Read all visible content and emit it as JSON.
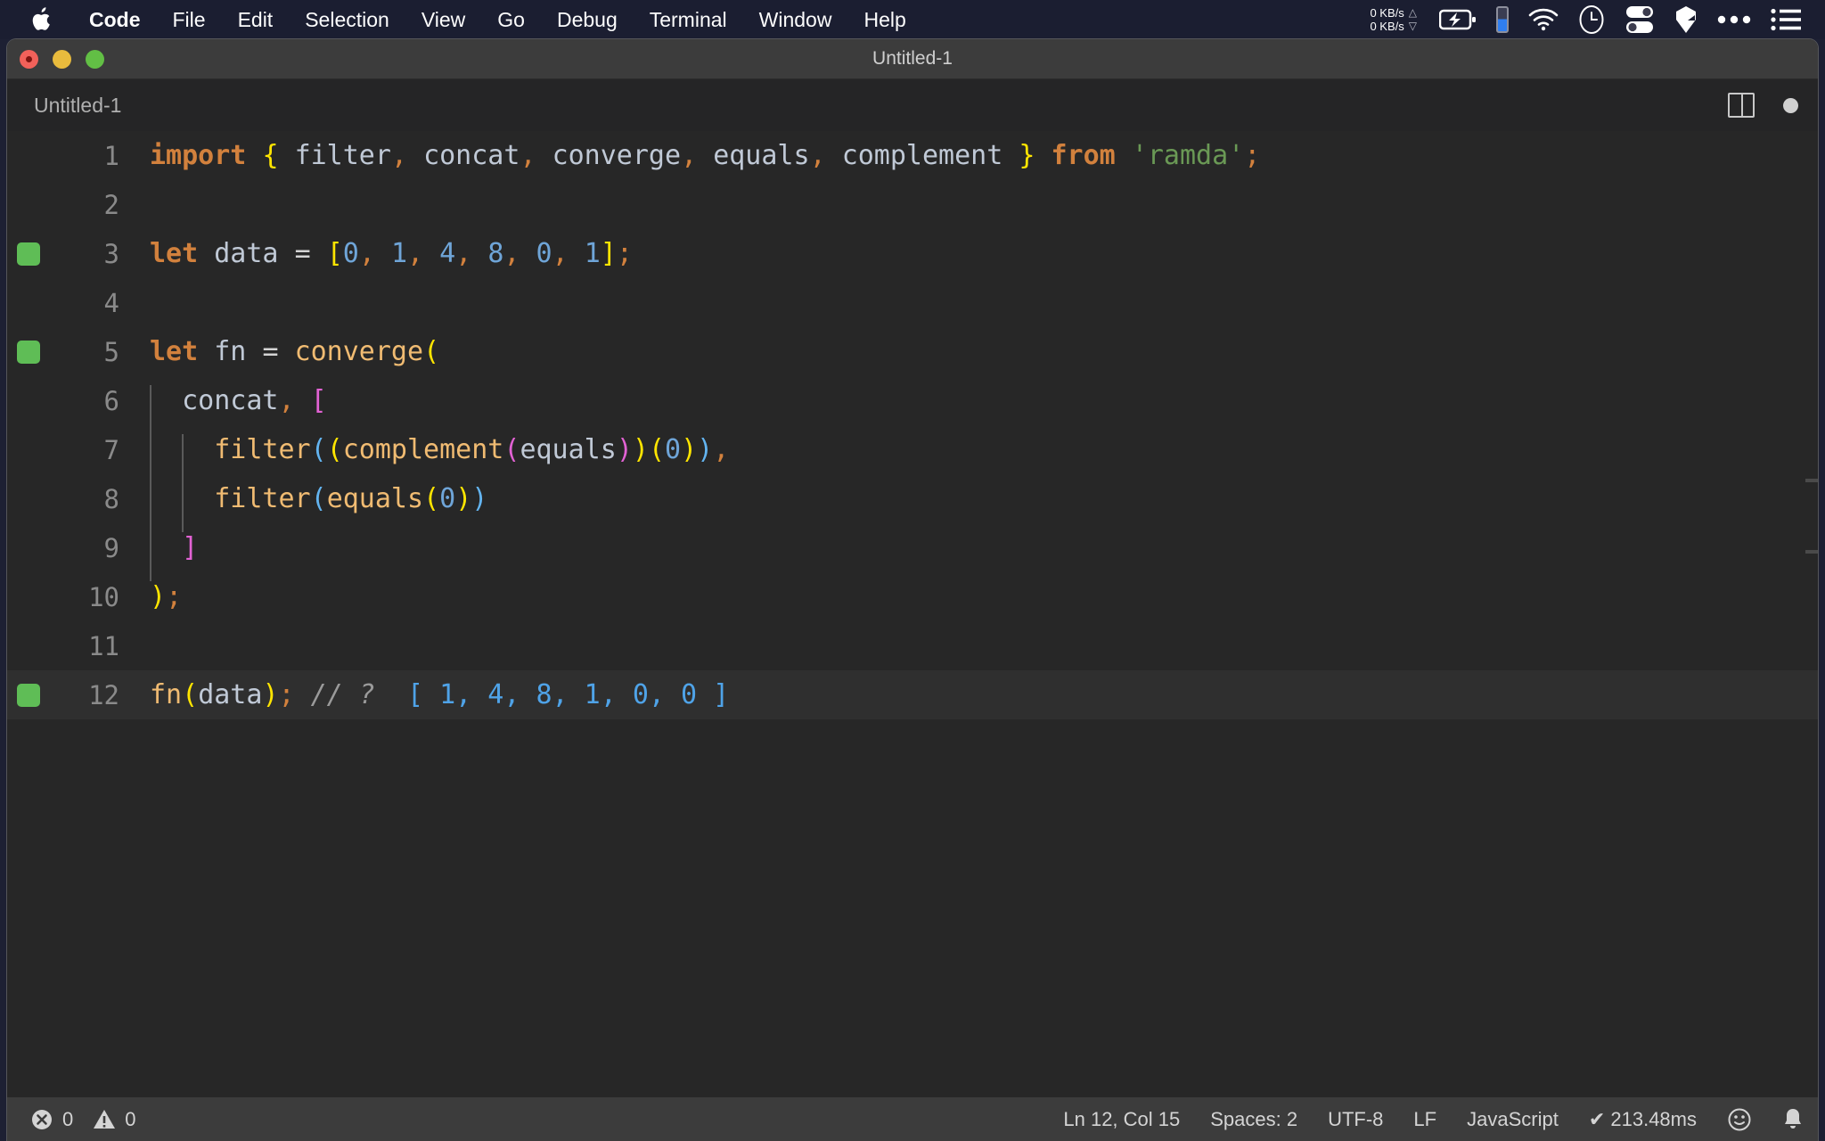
{
  "menubar": {
    "apple_icon": "apple-logo-icon",
    "items": [
      {
        "label": "Code",
        "bold": true
      },
      {
        "label": "File",
        "bold": false
      },
      {
        "label": "Edit",
        "bold": false
      },
      {
        "label": "Selection",
        "bold": false
      },
      {
        "label": "View",
        "bold": false
      },
      {
        "label": "Go",
        "bold": false
      },
      {
        "label": "Debug",
        "bold": false
      },
      {
        "label": "Terminal",
        "bold": false
      },
      {
        "label": "Window",
        "bold": false
      },
      {
        "label": "Help",
        "bold": false
      }
    ],
    "network": {
      "upload": "0 KB/s",
      "download": "0 KB/s",
      "up_arrow": "△",
      "down_arrow": "▽"
    },
    "icons": [
      "battery-charging-icon",
      "blue-level-indicator",
      "wifi-icon",
      "clock-icon",
      "toggles-icon",
      "shield-icon",
      "ellipsis-icon",
      "list-icon"
    ]
  },
  "window": {
    "title": "Untitled-1",
    "traffic_lights": [
      "close-button",
      "minimize-button",
      "zoom-button"
    ]
  },
  "tabstrip": {
    "tab_label": "Untitled-1",
    "split_editor_icon": "split-editor-icon",
    "unsaved_dot": "unsaved-indicator"
  },
  "editor": {
    "language": "JavaScript",
    "active_line": 12,
    "breakpoint_lines": [
      3,
      5,
      12
    ],
    "lines": [
      {
        "n": "1",
        "tokens": [
          {
            "t": "import",
            "c": "t-kw"
          },
          {
            "t": " ",
            "c": "t-op"
          },
          {
            "t": "{",
            "c": "t-y"
          },
          {
            "t": " ",
            "c": "t-op"
          },
          {
            "t": "filter",
            "c": "t-id"
          },
          {
            "t": ",",
            "c": "t-punc-or"
          },
          {
            "t": " ",
            "c": "t-op"
          },
          {
            "t": "concat",
            "c": "t-id"
          },
          {
            "t": ",",
            "c": "t-punc-or"
          },
          {
            "t": " ",
            "c": "t-op"
          },
          {
            "t": "converge",
            "c": "t-id"
          },
          {
            "t": ",",
            "c": "t-punc-or"
          },
          {
            "t": " ",
            "c": "t-op"
          },
          {
            "t": "equals",
            "c": "t-id"
          },
          {
            "t": ",",
            "c": "t-punc-or"
          },
          {
            "t": " ",
            "c": "t-op"
          },
          {
            "t": "complement",
            "c": "t-id"
          },
          {
            "t": " ",
            "c": "t-op"
          },
          {
            "t": "}",
            "c": "t-y"
          },
          {
            "t": " ",
            "c": "t-op"
          },
          {
            "t": "from",
            "c": "t-kw"
          },
          {
            "t": " ",
            "c": "t-op"
          },
          {
            "t": "'ramda'",
            "c": "t-str"
          },
          {
            "t": ";",
            "c": "t-punc-or"
          }
        ]
      },
      {
        "n": "2",
        "tokens": []
      },
      {
        "n": "3",
        "tokens": [
          {
            "t": "let",
            "c": "t-kw"
          },
          {
            "t": " ",
            "c": "t-op"
          },
          {
            "t": "data",
            "c": "t-id"
          },
          {
            "t": " ",
            "c": "t-op"
          },
          {
            "t": "=",
            "c": "t-op"
          },
          {
            "t": " ",
            "c": "t-op"
          },
          {
            "t": "[",
            "c": "t-y"
          },
          {
            "t": "0",
            "c": "t-num"
          },
          {
            "t": ",",
            "c": "t-punc-or"
          },
          {
            "t": " ",
            "c": "t-op"
          },
          {
            "t": "1",
            "c": "t-num"
          },
          {
            "t": ",",
            "c": "t-punc-or"
          },
          {
            "t": " ",
            "c": "t-op"
          },
          {
            "t": "4",
            "c": "t-num"
          },
          {
            "t": ",",
            "c": "t-punc-or"
          },
          {
            "t": " ",
            "c": "t-op"
          },
          {
            "t": "8",
            "c": "t-num"
          },
          {
            "t": ",",
            "c": "t-punc-or"
          },
          {
            "t": " ",
            "c": "t-op"
          },
          {
            "t": "0",
            "c": "t-num"
          },
          {
            "t": ",",
            "c": "t-punc-or"
          },
          {
            "t": " ",
            "c": "t-op"
          },
          {
            "t": "1",
            "c": "t-num"
          },
          {
            "t": "]",
            "c": "t-y"
          },
          {
            "t": ";",
            "c": "t-punc-or"
          }
        ]
      },
      {
        "n": "4",
        "tokens": []
      },
      {
        "n": "5",
        "tokens": [
          {
            "t": "let",
            "c": "t-kw"
          },
          {
            "t": " ",
            "c": "t-op"
          },
          {
            "t": "fn",
            "c": "t-id"
          },
          {
            "t": " ",
            "c": "t-op"
          },
          {
            "t": "=",
            "c": "t-op"
          },
          {
            "t": " ",
            "c": "t-op"
          },
          {
            "t": "converge",
            "c": "t-fn"
          },
          {
            "t": "(",
            "c": "t-y"
          }
        ]
      },
      {
        "n": "6",
        "tokens": [
          {
            "t": "  ",
            "c": "t-op"
          },
          {
            "t": "concat",
            "c": "t-id"
          },
          {
            "t": ",",
            "c": "t-punc-or"
          },
          {
            "t": " ",
            "c": "t-op"
          },
          {
            "t": "[",
            "c": "t-m"
          }
        ]
      },
      {
        "n": "7",
        "tokens": [
          {
            "t": "    ",
            "c": "t-op"
          },
          {
            "t": "filter",
            "c": "t-fn"
          },
          {
            "t": "(",
            "c": "t-b"
          },
          {
            "t": "(",
            "c": "t-y"
          },
          {
            "t": "complement",
            "c": "t-fn"
          },
          {
            "t": "(",
            "c": "t-m"
          },
          {
            "t": "equals",
            "c": "t-id"
          },
          {
            "t": ")",
            "c": "t-m"
          },
          {
            "t": ")",
            "c": "t-y"
          },
          {
            "t": "(",
            "c": "t-y"
          },
          {
            "t": "0",
            "c": "t-num"
          },
          {
            "t": ")",
            "c": "t-y"
          },
          {
            "t": ")",
            "c": "t-b"
          },
          {
            "t": ",",
            "c": "t-punc-or"
          }
        ]
      },
      {
        "n": "8",
        "tokens": [
          {
            "t": "    ",
            "c": "t-op"
          },
          {
            "t": "filter",
            "c": "t-fn"
          },
          {
            "t": "(",
            "c": "t-b"
          },
          {
            "t": "equals",
            "c": "t-fn"
          },
          {
            "t": "(",
            "c": "t-y"
          },
          {
            "t": "0",
            "c": "t-num"
          },
          {
            "t": ")",
            "c": "t-y"
          },
          {
            "t": ")",
            "c": "t-b"
          }
        ]
      },
      {
        "n": "9",
        "tokens": [
          {
            "t": "  ",
            "c": "t-op"
          },
          {
            "t": "]",
            "c": "t-m"
          }
        ]
      },
      {
        "n": "10",
        "tokens": [
          {
            "t": ")",
            "c": "t-y"
          },
          {
            "t": ";",
            "c": "t-punc-or"
          }
        ]
      },
      {
        "n": "11",
        "tokens": []
      },
      {
        "n": "12",
        "tokens": [
          {
            "t": "fn",
            "c": "t-fn"
          },
          {
            "t": "(",
            "c": "t-y"
          },
          {
            "t": "data",
            "c": "t-id"
          },
          {
            "t": ")",
            "c": "t-y"
          },
          {
            "t": ";",
            "c": "t-punc-or"
          },
          {
            "t": " ",
            "c": "t-op"
          },
          {
            "t": "// ?",
            "c": "t-comment"
          },
          {
            "t": "  ",
            "c": "t-op"
          },
          {
            "t": "[ 1, 4, 8, 1, 0, 0 ]",
            "c": "t-result"
          }
        ]
      }
    ]
  },
  "statusbar": {
    "errors": "0",
    "warnings": "0",
    "error_icon": "error-circle-icon",
    "warning_icon": "warning-triangle-icon",
    "cursor_position": "Ln 12, Col 15",
    "indentation": "Spaces: 2",
    "encoding": "UTF-8",
    "eol": "LF",
    "language": "JavaScript",
    "run_time": "✔ 213.48ms",
    "feedback_icon": "smiley-icon",
    "notifications_icon": "bell-icon"
  },
  "colors": {
    "menubar_bg": "#1b1e31",
    "titlebar_bg": "#3c3c3c",
    "editor_bg": "#272727",
    "statusbar_bg": "#3c3c3c",
    "breakpoint_green": "#5fbd56",
    "keyword_orange": "#d2813d",
    "function_tan": "#f0bb72",
    "number_blue": "#6fa5d8",
    "string_green": "#6a9955",
    "bracket_yellow": "#ffe500",
    "bracket_blue": "#63b4f0",
    "bracket_magenta": "#e262d4",
    "result_blue": "#4fa3e8"
  }
}
